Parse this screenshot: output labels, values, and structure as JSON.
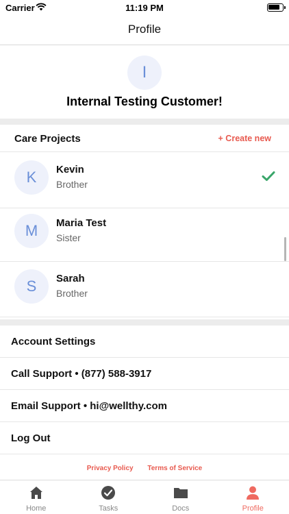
{
  "status_bar": {
    "carrier": "Carrier",
    "time": "11:19 PM"
  },
  "nav": {
    "title": "Profile"
  },
  "profile": {
    "initial": "I",
    "name": "Internal Testing Customer!"
  },
  "care_projects": {
    "title": "Care Projects",
    "create_label": "+ Create new",
    "items": [
      {
        "initial": "K",
        "name": "Kevin",
        "relation": "Brother",
        "selected": true
      },
      {
        "initial": "M",
        "name": "Maria Test",
        "relation": "Sister",
        "selected": false
      },
      {
        "initial": "S",
        "name": "Sarah",
        "relation": "Brother",
        "selected": false
      }
    ]
  },
  "menu": {
    "account_settings": "Account Settings",
    "call_support": "Call Support • (877) 588-3917",
    "email_support": "Email Support • hi@wellthy.com",
    "log_out": "Log Out"
  },
  "footer": {
    "privacy": "Privacy Policy",
    "terms": "Terms of Service"
  },
  "tabs": [
    {
      "label": "Home",
      "icon": "home-icon"
    },
    {
      "label": "Tasks",
      "icon": "check-circle-icon"
    },
    {
      "label": "Docs",
      "icon": "folder-icon"
    },
    {
      "label": "Profile",
      "icon": "person-icon",
      "active": true
    }
  ],
  "colors": {
    "accent": "#e85a4f",
    "avatar_bg": "#eef1fb",
    "avatar_text": "#6a8fd8",
    "check": "#3aa66a"
  }
}
